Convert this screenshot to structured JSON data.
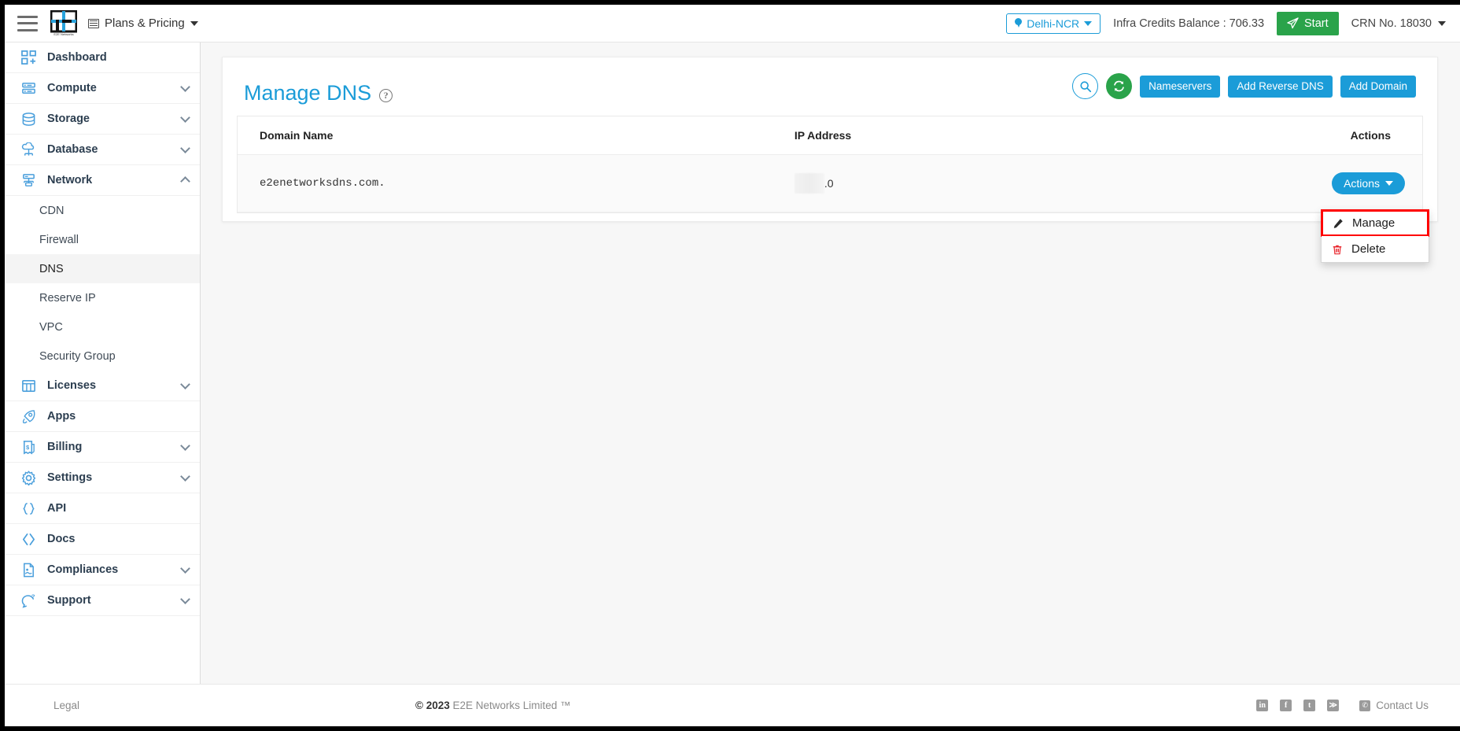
{
  "header": {
    "menu_icon": "hamburger-icon",
    "logo_alt": "E2E Networks",
    "plans_label": "Plans & Pricing",
    "region": "Delhi-NCR",
    "credits_label": "Infra Credits Balance : 706.33",
    "start_label": "Start",
    "crn_label": "CRN No. 18030"
  },
  "sidebar": {
    "items": [
      {
        "label": "Dashboard",
        "icon": "dashboard-icon",
        "expandable": false,
        "expanded": false
      },
      {
        "label": "Compute",
        "icon": "server-icon",
        "expandable": true,
        "expanded": false
      },
      {
        "label": "Storage",
        "icon": "database-stack-icon",
        "expandable": true,
        "expanded": false
      },
      {
        "label": "Database",
        "icon": "cloud-database-icon",
        "expandable": true,
        "expanded": false
      },
      {
        "label": "Network",
        "icon": "network-icon",
        "expandable": true,
        "expanded": true
      },
      {
        "label": "Licenses",
        "icon": "license-grid-icon",
        "expandable": true,
        "expanded": false
      },
      {
        "label": "Apps",
        "icon": "rocket-icon",
        "expandable": false,
        "expanded": false
      },
      {
        "label": "Billing",
        "icon": "invoice-icon",
        "expandable": true,
        "expanded": false
      },
      {
        "label": "Settings",
        "icon": "gear-icon",
        "expandable": true,
        "expanded": false
      },
      {
        "label": "API",
        "icon": "braces-icon",
        "expandable": false,
        "expanded": false
      },
      {
        "label": "Docs",
        "icon": "code-brackets-icon",
        "expandable": false,
        "expanded": false
      },
      {
        "label": "Compliances",
        "icon": "document-icon",
        "expandable": true,
        "expanded": false
      },
      {
        "label": "Support",
        "icon": "support-icon",
        "expandable": true,
        "expanded": false
      }
    ],
    "network_subitems": [
      {
        "label": "CDN",
        "active": false
      },
      {
        "label": "Firewall",
        "active": false
      },
      {
        "label": "DNS",
        "active": true
      },
      {
        "label": "Reserve IP",
        "active": false
      },
      {
        "label": "VPC",
        "active": false
      },
      {
        "label": "Security Group",
        "active": false
      }
    ]
  },
  "main": {
    "page_title": "Manage DNS",
    "help_glyph": "?",
    "toolbar": {
      "search_icon": "search-icon",
      "refresh_icon": "refresh-icon",
      "nameservers_label": "Nameservers",
      "add_reverse_dns_label": "Add Reverse DNS",
      "add_domain_label": "Add Domain"
    },
    "table": {
      "columns": [
        "Domain Name",
        "IP Address",
        "Actions"
      ],
      "rows": [
        {
          "domain_name": "e2enetworksdns.com.",
          "ip_address_redacted": true,
          "ip_address_suffix": ".0",
          "action_label": "Actions"
        }
      ]
    },
    "dropdown": {
      "open": true,
      "items": [
        {
          "label": "Manage",
          "icon": "pencil-icon",
          "highlighted": true
        },
        {
          "label": "Delete",
          "icon": "trash-icon",
          "highlighted": false
        }
      ]
    }
  },
  "footer": {
    "legal_label": "Legal",
    "copyright": "© 2023 E2E Networks Limited ™",
    "copyright_year": "© 2023",
    "copyright_name": "E2E Networks Limited ™",
    "social": [
      {
        "name": "linkedin-icon",
        "glyph": "in"
      },
      {
        "name": "facebook-icon",
        "glyph": "f"
      },
      {
        "name": "twitter-icon",
        "glyph": "t"
      },
      {
        "name": "rss-icon",
        "glyph": "≫"
      }
    ],
    "contact_label": "Contact Us"
  },
  "colors": {
    "brand_blue": "#1b9cd8",
    "green": "#2aa34a",
    "highlight_red": "#ff0000",
    "sidebar_active": "#f4f4f4",
    "page_bg": "#f7f7f7"
  }
}
